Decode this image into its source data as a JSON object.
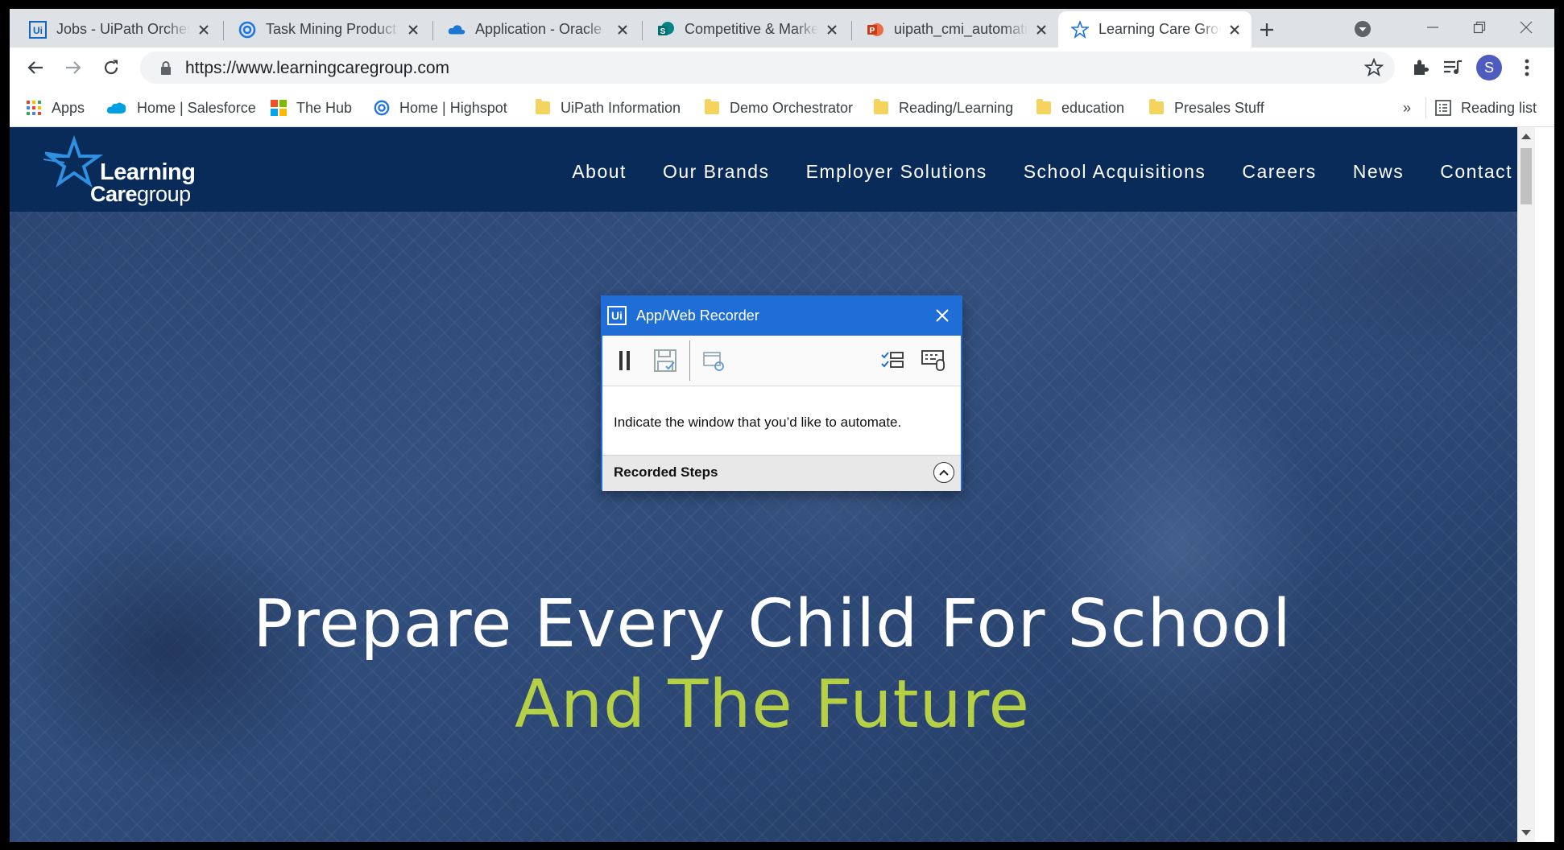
{
  "tabs": [
    {
      "title": "Jobs - UiPath Orchestrator",
      "icon": "uipath-icon"
    },
    {
      "title": "Task Mining Product",
      "icon": "highspot-icon"
    },
    {
      "title": "Application - Oracle",
      "icon": "onedrive-icon"
    },
    {
      "title": "Competitive & Market",
      "icon": "sharepoint-icon"
    },
    {
      "title": "uipath_cmi_automation",
      "icon": "powerpoint-icon"
    },
    {
      "title": "Learning Care Group",
      "icon": "learning-care-star-icon",
      "active": true
    }
  ],
  "address": {
    "url": "https://www.learningcaregroup.com",
    "avatar_letter": "S"
  },
  "bookmarks": [
    {
      "label": "Apps",
      "icon": "apps-grid-icon"
    },
    {
      "label": "Home | Salesforce",
      "icon": "salesforce-icon"
    },
    {
      "label": "The Hub",
      "icon": "microsoft-icon"
    },
    {
      "label": "Home | Highspot",
      "icon": "highspot-icon"
    },
    {
      "label": "UiPath Information",
      "icon": "folder-icon"
    },
    {
      "label": "Demo Orchestrator",
      "icon": "folder-icon"
    },
    {
      "label": "Reading/Learning",
      "icon": "folder-icon"
    },
    {
      "label": "education",
      "icon": "folder-icon"
    },
    {
      "label": "Presales Stuff",
      "icon": "folder-icon"
    }
  ],
  "bookmarks_overflow": "»",
  "reading_list": "Reading list",
  "site": {
    "logo_line1": "Learning",
    "logo_line2_bold": "Care",
    "logo_line2_rest": "group",
    "nav": [
      "About",
      "Our Brands",
      "Employer Solutions",
      "School Acquisitions",
      "Careers",
      "News",
      "Contact"
    ],
    "headline_line1": "Prepare Every Child For School",
    "headline_line2": "And The Future",
    "accent_color": "#b6d045",
    "nav_bg": "#092b5a"
  },
  "recorder": {
    "logo": "Ui",
    "title": "App/Web Recorder",
    "message": "Indicate the window that you’d like to automate.",
    "steps_label": "Recorded Steps",
    "accent": "#1f6ed8"
  }
}
